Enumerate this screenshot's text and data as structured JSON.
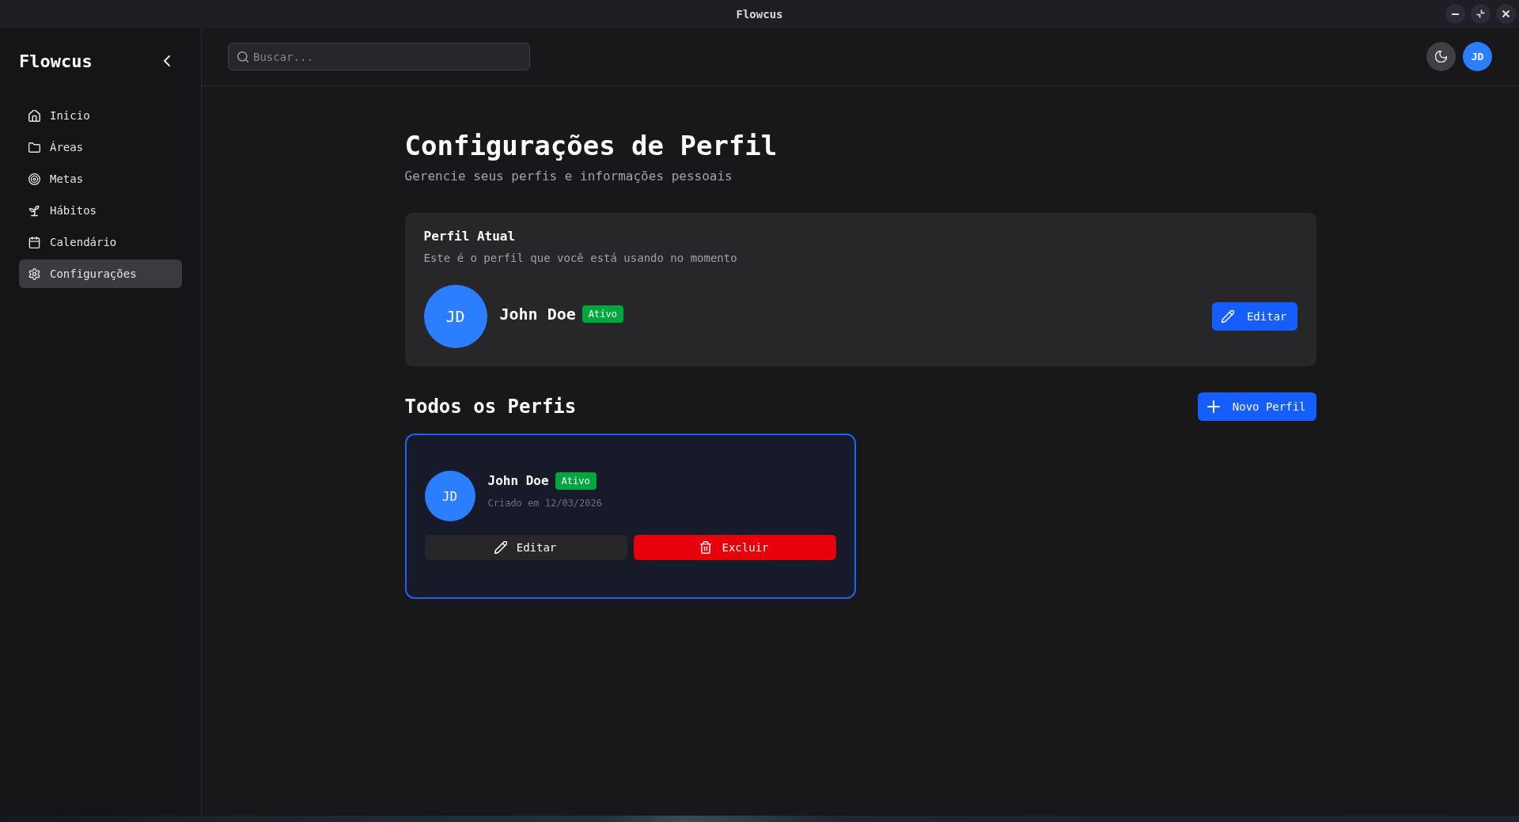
{
  "window": {
    "title": "Flowcus"
  },
  "sidebar": {
    "logo": "Flowcus",
    "items": [
      {
        "label": "Inicio",
        "kind": "home",
        "selected": false
      },
      {
        "label": "Áreas",
        "kind": "folder",
        "selected": false
      },
      {
        "label": "Metas",
        "kind": "target",
        "selected": false
      },
      {
        "label": "Hábitos",
        "kind": "sprout",
        "selected": false
      },
      {
        "label": "Calendário",
        "kind": "calendar",
        "selected": false
      },
      {
        "label": "Configurações",
        "kind": "settings",
        "selected": true
      }
    ]
  },
  "topbar": {
    "search": {
      "placeholder": "Buscar..."
    },
    "avatar_initials": "JD"
  },
  "page": {
    "title": "Configurações de Perfil",
    "subtitle": "Gerencie seus perfis e informações pessoais"
  },
  "current_profile": {
    "title": "Perfil Atual",
    "description": "Este é o perfil que você está usando no momento",
    "avatar_initials": "JD",
    "name": "John Doe",
    "badge": "Ativo",
    "edit_button": "Editar"
  },
  "all_profiles": {
    "title": "Todos os Perfis",
    "new_button": "Novo Perfil",
    "profiles": [
      {
        "avatar_initials": "JD",
        "name": "John Doe",
        "badge": "Ativo",
        "created": "Criado em 12/03/2026",
        "selected": true,
        "edit_button": "Editar",
        "delete_button": "Excluir"
      }
    ]
  }
}
